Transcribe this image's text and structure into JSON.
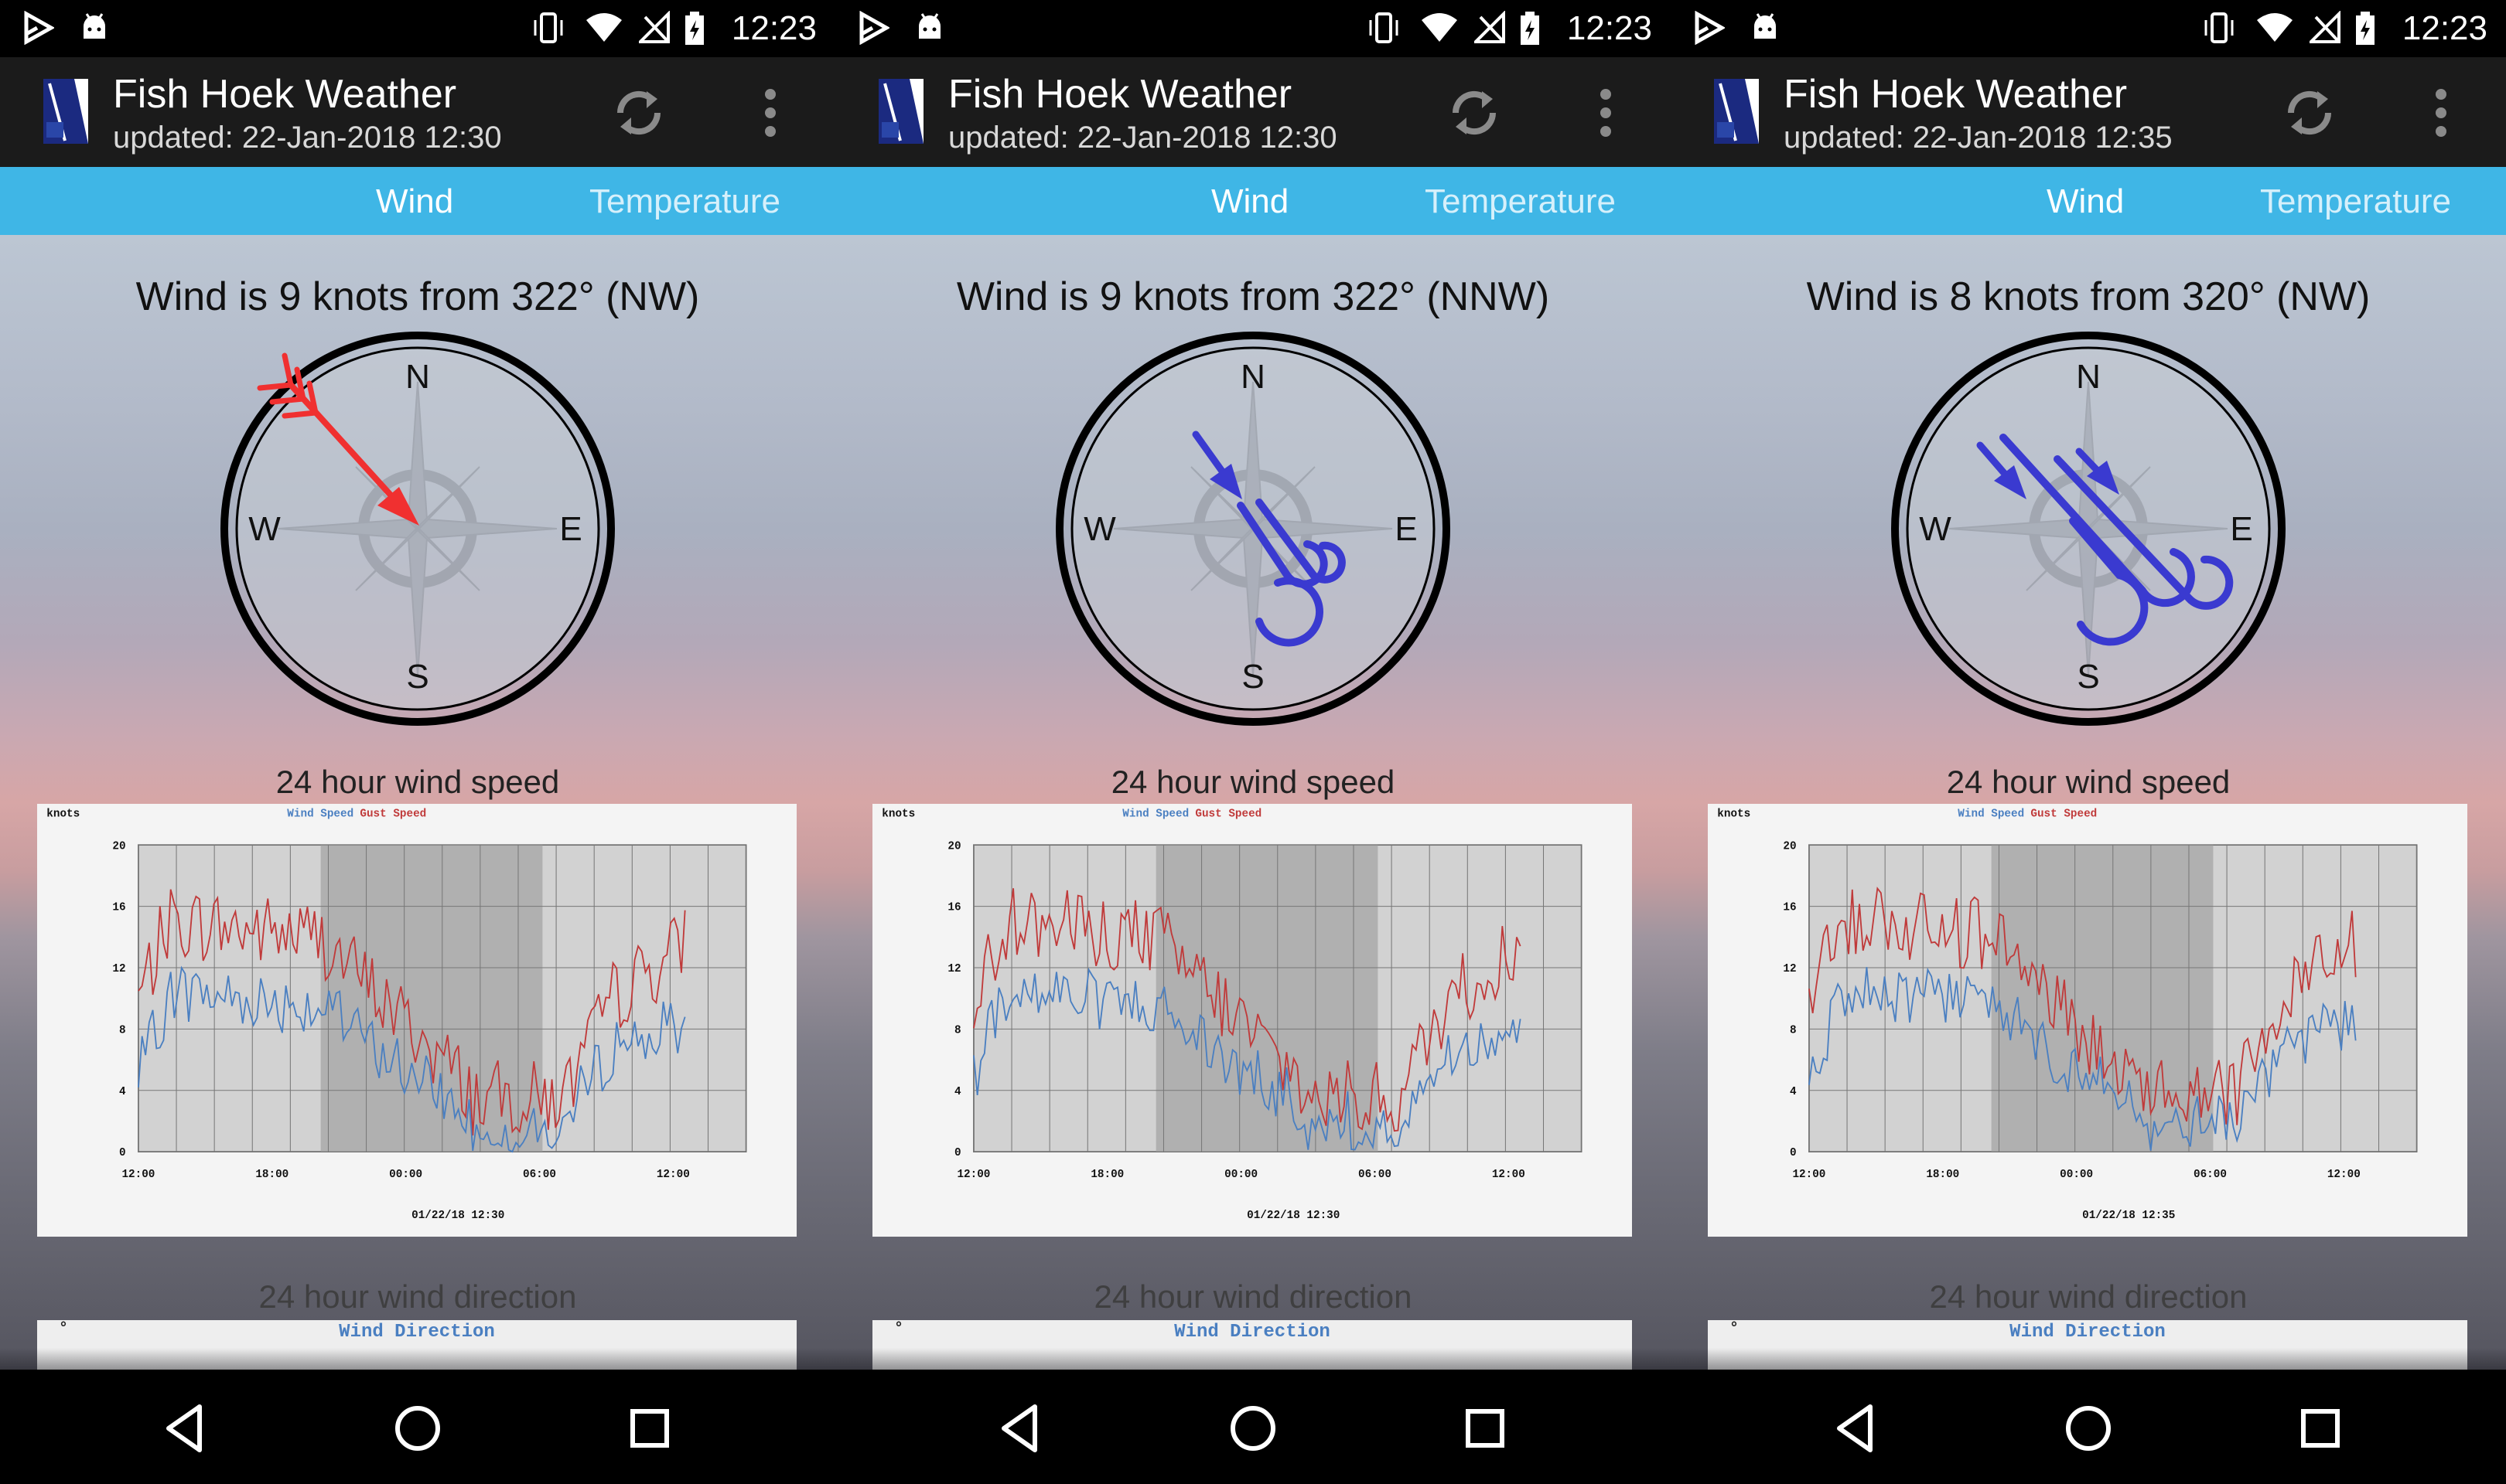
{
  "screens": [
    {
      "status_time": "12:23",
      "app_title": "Fish Hoek Weather",
      "updated": "updated: 22-Jan-2018 12:30",
      "tabs": {
        "wind": "Wind",
        "temperature": "Temperature"
      },
      "wind_text": "Wind is 9 knots from 322° (NW)",
      "wind_icon": "red-arrow-icon",
      "wind_icon_color": "#f03030",
      "chart_title": "24 hour wind speed",
      "chart_data": {
        "type": "line",
        "legend": {
          "y_unit": "knots",
          "series1": "Wind Speed",
          "series2": "Gust Speed"
        },
        "x_ticks": [
          "12:00",
          "18:00",
          "00:00",
          "06:00",
          "12:00"
        ],
        "y_ticks": [
          "20",
          "16",
          "12",
          "8",
          "4",
          "0"
        ],
        "ylim": [
          0,
          20
        ],
        "timestamp": "01/22/18 12:30"
      },
      "dir_title": "24 hour wind direction",
      "dir_legend": "Wind Direction",
      "dir_unit": "°"
    },
    {
      "status_time": "12:23",
      "app_title": "Fish Hoek Weather",
      "updated": "updated: 22-Jan-2018 12:30",
      "tabs": {
        "wind": "Wind",
        "temperature": "Temperature"
      },
      "wind_text": "Wind is 9 knots from 322° (NNW)",
      "wind_icon": "blue-wind-icon",
      "wind_icon_color": "#3a3ad0",
      "chart_title": "24 hour wind speed",
      "chart_data": {
        "type": "line",
        "legend": {
          "y_unit": "knots",
          "series1": "Wind Speed",
          "series2": "Gust Speed"
        },
        "x_ticks": [
          "12:00",
          "18:00",
          "00:00",
          "06:00",
          "12:00"
        ],
        "y_ticks": [
          "20",
          "16",
          "12",
          "8",
          "4",
          "0"
        ],
        "ylim": [
          0,
          20
        ],
        "timestamp": "01/22/18 12:30"
      },
      "dir_title": "24 hour wind direction",
      "dir_legend": "Wind Direction",
      "dir_unit": "°"
    },
    {
      "status_time": "12:23",
      "app_title": "Fish Hoek Weather",
      "updated": "updated: 22-Jan-2018 12:35",
      "tabs": {
        "wind": "Wind",
        "temperature": "Temperature"
      },
      "wind_text": "Wind is 8 knots from 320° (NW)",
      "wind_icon": "blue-strong-wind-icon",
      "wind_icon_color": "#3a3ad0",
      "chart_title": "24 hour wind speed",
      "chart_data": {
        "type": "line",
        "legend": {
          "y_unit": "knots",
          "series1": "Wind Speed",
          "series2": "Gust Speed"
        },
        "x_ticks": [
          "12:00",
          "18:00",
          "00:00",
          "06:00",
          "12:00"
        ],
        "y_ticks": [
          "20",
          "16",
          "12",
          "8",
          "4",
          "0"
        ],
        "ylim": [
          0,
          20
        ],
        "timestamp": "01/22/18 12:35"
      },
      "dir_title": "24 hour wind direction",
      "dir_legend": "Wind Direction",
      "dir_unit": "°"
    }
  ],
  "colors": {
    "appbar": "#1b1b1b",
    "tab_strip": "#3fb6e6",
    "wind_series": "#4a7fc1",
    "gust_series": "#c03a3a"
  },
  "compass_labels": {
    "n": "N",
    "e": "E",
    "s": "S",
    "w": "W"
  }
}
